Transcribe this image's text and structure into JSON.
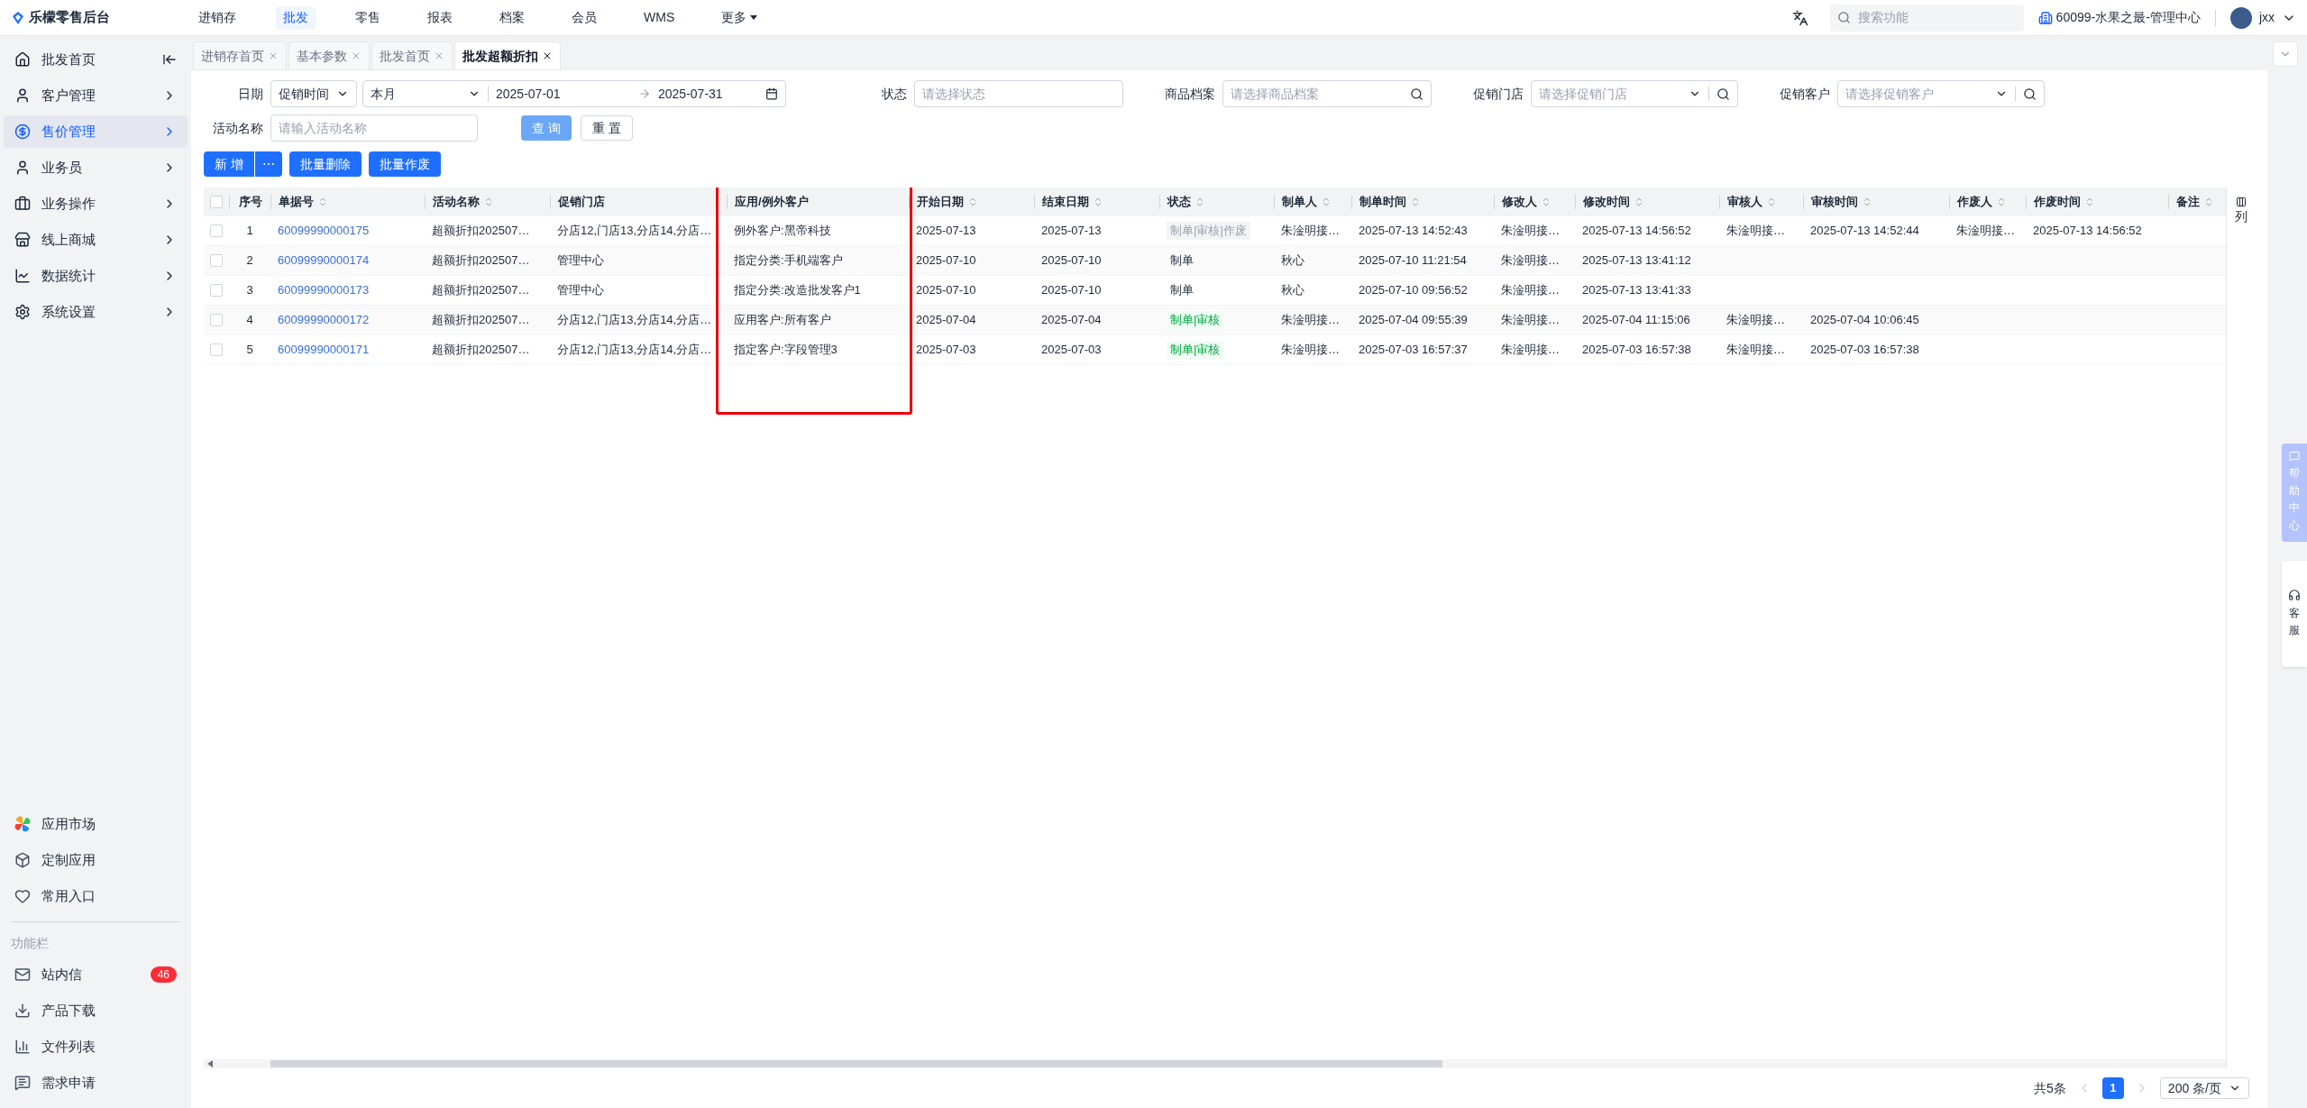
{
  "app": {
    "title": "乐檬零售后台"
  },
  "top_nav": [
    {
      "label": "进销存",
      "selected": false
    },
    {
      "label": "批发",
      "selected": true
    },
    {
      "label": "零售",
      "selected": false
    },
    {
      "label": "报表",
      "selected": false
    },
    {
      "label": "档案",
      "selected": false
    },
    {
      "label": "会员",
      "selected": false
    },
    {
      "label": "WMS",
      "selected": false
    },
    {
      "label": "更多",
      "selected": false,
      "dropdown": true
    }
  ],
  "header": {
    "search_placeholder": "搜索功能",
    "org": "60099-水果之最-管理中心",
    "user": "jxx"
  },
  "sidebar": {
    "items": [
      {
        "label": "批发首页",
        "selected": false,
        "has_children": false
      },
      {
        "label": "客户管理",
        "selected": false,
        "has_children": true
      },
      {
        "label": "售价管理",
        "selected": true,
        "has_children": true
      },
      {
        "label": "业务员",
        "selected": false,
        "has_children": true
      },
      {
        "label": "业务操作",
        "selected": false,
        "has_children": true
      },
      {
        "label": "线上商城",
        "selected": false,
        "has_children": true
      },
      {
        "label": "数据统计",
        "selected": false,
        "has_children": true
      },
      {
        "label": "系统设置",
        "selected": false,
        "has_children": true
      }
    ],
    "bottom_items": [
      {
        "label": "应用市场"
      },
      {
        "label": "定制应用"
      },
      {
        "label": "常用入口"
      }
    ],
    "section_label": "功能栏",
    "tool_items": [
      {
        "label": "站内信",
        "badge": "46"
      },
      {
        "label": "产品下载"
      },
      {
        "label": "文件列表"
      },
      {
        "label": "需求申请"
      }
    ]
  },
  "tabs": [
    {
      "label": "进销存首页",
      "selected": false
    },
    {
      "label": "基本参数",
      "selected": false
    },
    {
      "label": "批发首页",
      "selected": false
    },
    {
      "label": "批发超额折扣",
      "selected": true
    }
  ],
  "filters": {
    "date_label": "日期",
    "date_type": "促销时间",
    "period": "本月",
    "start": "2025-07-01",
    "end": "2025-07-31",
    "status_label": "状态",
    "status_placeholder": "请选择状态",
    "product_label": "商品档案",
    "product_placeholder": "请选择商品档案",
    "store_label": "促销门店",
    "store_placeholder": "请选择促销门店",
    "customer_label": "促销客户",
    "customer_placeholder": "请选择促销客户",
    "name_label": "活动名称",
    "name_placeholder": "请输入活动名称",
    "query": "查 询",
    "reset": "重 置"
  },
  "actions": {
    "add": "新 增",
    "more": "⋯",
    "batch_delete": "批量删除",
    "batch_void": "批量作废"
  },
  "table": {
    "columns": [
      {
        "label": "序号",
        "sortable": false,
        "highlighted": false
      },
      {
        "label": "单据号",
        "sortable": true,
        "highlighted": false
      },
      {
        "label": "活动名称",
        "sortable": true,
        "highlighted": false
      },
      {
        "label": "促销门店",
        "sortable": false,
        "highlighted": false
      },
      {
        "label": "应用/例外客户",
        "sortable": false,
        "highlighted": true
      },
      {
        "label": "开始日期",
        "sortable": true,
        "highlighted": false
      },
      {
        "label": "结束日期",
        "sortable": true,
        "highlighted": false
      },
      {
        "label": "状态",
        "sortable": true,
        "highlighted": false
      },
      {
        "label": "制单人",
        "sortable": true,
        "highlighted": false
      },
      {
        "label": "制单时间",
        "sortable": true,
        "highlighted": false
      },
      {
        "label": "修改人",
        "sortable": true,
        "highlighted": false
      },
      {
        "label": "修改时间",
        "sortable": true,
        "highlighted": false
      },
      {
        "label": "审核人",
        "sortable": true,
        "highlighted": false
      },
      {
        "label": "审核时间",
        "sortable": true,
        "highlighted": false
      },
      {
        "label": "作废人",
        "sortable": true,
        "highlighted": false
      },
      {
        "label": "作废时间",
        "sortable": true,
        "highlighted": false
      },
      {
        "label": "备注",
        "sortable": true,
        "highlighted": false
      }
    ],
    "all_checked": false,
    "rows": [
      {
        "checked": false,
        "no": "1",
        "doc_no": "60099990000175",
        "name": "超额折扣202507…",
        "stores": "分店12,门店13,分店14,分店…",
        "customers": "例外客户:黑帝科技",
        "start": "2025-07-13",
        "end": "2025-07-13",
        "status": {
          "text": "制单|审核|作废",
          "kind": "voided"
        },
        "creator": "朱淦明接…",
        "created": "2025-07-13 14:52:43",
        "modifier": "朱淦明接…",
        "modified": "2025-07-13 14:56:52",
        "auditor": "朱淦明接…",
        "audited": "2025-07-13 14:52:44",
        "voider": "朱淦明接…",
        "voided": "2025-07-13 14:56:52"
      },
      {
        "checked": false,
        "no": "2",
        "doc_no": "60099990000174",
        "name": "超额折扣202507…",
        "stores": "管理中心",
        "customers": "指定分类:手机端客户",
        "start": "2025-07-10",
        "end": "2025-07-10",
        "status": {
          "text": "制单",
          "kind": "draft"
        },
        "creator": "秋心",
        "created": "2025-07-10 11:21:54",
        "modifier": "朱淦明接…",
        "modified": "2025-07-13 13:41:12"
      },
      {
        "checked": false,
        "no": "3",
        "doc_no": "60099990000173",
        "name": "超额折扣202507…",
        "stores": "管理中心",
        "customers": "指定分类:改造批发客户1",
        "start": "2025-07-10",
        "end": "2025-07-10",
        "status": {
          "text": "制单",
          "kind": "draft"
        },
        "creator": "秋心",
        "created": "2025-07-10 09:56:52",
        "modifier": "朱淦明接…",
        "modified": "2025-07-13 13:41:33"
      },
      {
        "checked": false,
        "no": "4",
        "doc_no": "60099990000172",
        "name": "超额折扣202507…",
        "stores": "分店12,门店13,分店14,分店…",
        "customers": "应用客户:所有客户",
        "start": "2025-07-04",
        "end": "2025-07-04",
        "status": {
          "text": "制单|审核",
          "kind": "approved"
        },
        "creator": "朱淦明接…",
        "created": "2025-07-04 09:55:39",
        "modifier": "朱淦明接…",
        "modified": "2025-07-04 11:15:06",
        "auditor": "朱淦明接…",
        "audited": "2025-07-04 10:06:45"
      },
      {
        "checked": false,
        "no": "5",
        "doc_no": "60099990000171",
        "name": "超额折扣202507…",
        "stores": "分店12,门店13,分店14,分店…",
        "customers": "指定客户:字段管理3",
        "start": "2025-07-03",
        "end": "2025-07-03",
        "status": {
          "text": "制单|审核",
          "kind": "approved"
        },
        "creator": "朱淦明接…",
        "created": "2025-07-03 16:57:37",
        "modifier": "朱淦明接…",
        "modified": "2025-07-03 16:57:38",
        "auditor": "朱淦明接…",
        "audited": "2025-07-03 16:57:38"
      }
    ]
  },
  "column_settings": "列",
  "pagination": {
    "total": "共5条",
    "pages": [
      {
        "label": "1",
        "selected": true
      }
    ],
    "page_size": "200 条/页"
  },
  "floating": {
    "help": "帮助中心",
    "service": "客服"
  }
}
